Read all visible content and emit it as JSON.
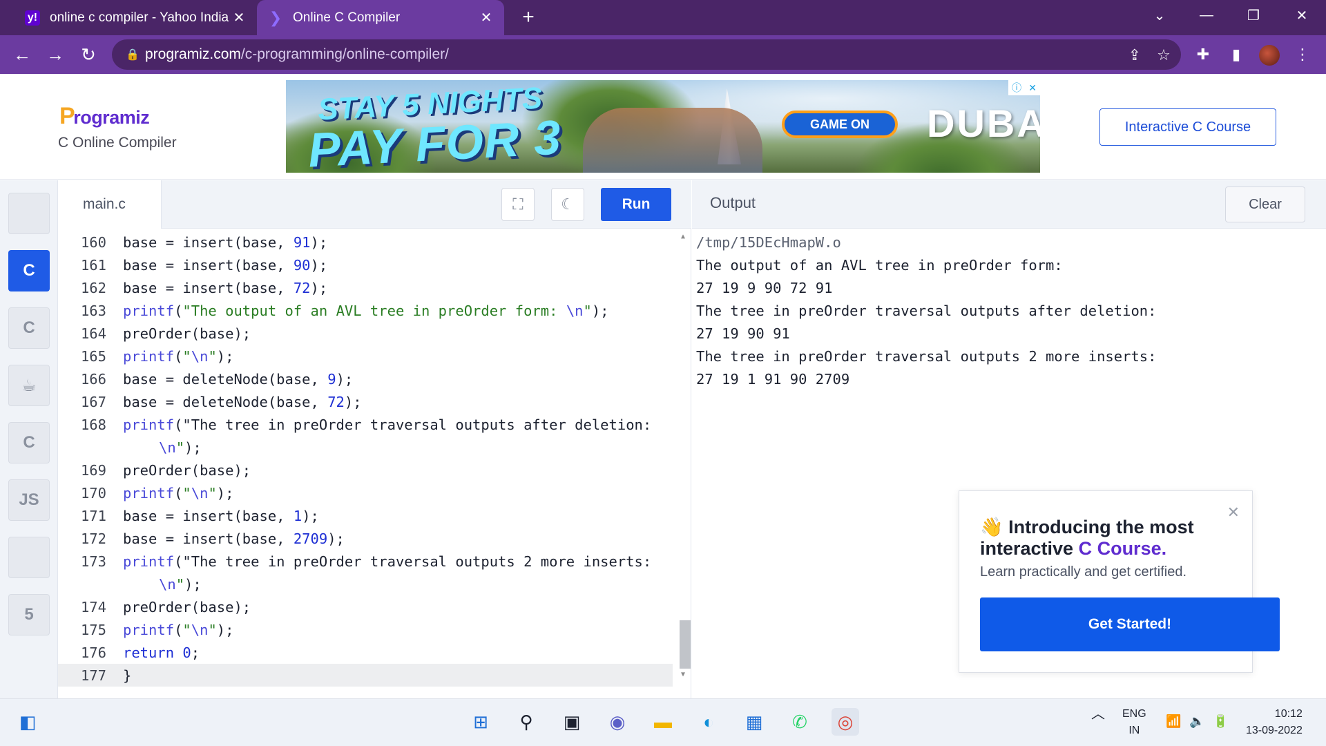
{
  "browser": {
    "tabs": [
      {
        "title": "online c compiler - Yahoo India S",
        "favicon": "yahoo-icon",
        "active": false
      },
      {
        "title": "Online C Compiler",
        "favicon": "programiz-icon",
        "active": true
      }
    ],
    "url_domain": "programiz.com",
    "url_path": "/c-programming/online-compiler/"
  },
  "header": {
    "logo_text": "rogramiz",
    "logo_initial": "P",
    "subtitle": "C Online Compiler",
    "ad": {
      "headline1": "STAY 5 NIGHTS",
      "headline2": "PAY FOR 3",
      "button": "GAME ON",
      "brand": "DUBAI"
    },
    "course_button": "Interactive C Course"
  },
  "languages": [
    {
      "name": "python-icon",
      "label": "",
      "active": false
    },
    {
      "name": "c-icon",
      "label": "C",
      "active": true
    },
    {
      "name": "cpp-icon",
      "label": "C",
      "active": false
    },
    {
      "name": "java-icon",
      "label": "☕",
      "active": false
    },
    {
      "name": "csharp-icon",
      "label": "C",
      "active": false
    },
    {
      "name": "js-icon",
      "label": "JS",
      "active": false
    },
    {
      "name": "sql-icon",
      "label": "",
      "active": false
    },
    {
      "name": "html5-icon",
      "label": "5",
      "active": false
    }
  ],
  "editor": {
    "file_name": "main.c",
    "run_label": "Run",
    "active_line": "177"
  },
  "code_lines": [
    {
      "ln": "160",
      "text": "base = insert(base, 91);"
    },
    {
      "ln": "161",
      "text": "base = insert(base, 90);"
    },
    {
      "ln": "162",
      "text": "base = insert(base, 72);"
    },
    {
      "ln": "163",
      "text": "printf(\"The output of an AVL tree in preOrder form: \\n\");"
    },
    {
      "ln": "164",
      "text": "preOrder(base);"
    },
    {
      "ln": "165",
      "text": "printf(\"\\n\");"
    },
    {
      "ln": "166",
      "text": "base = deleteNode(base, 9);"
    },
    {
      "ln": "167",
      "text": "base = deleteNode(base, 72);"
    },
    {
      "ln": "168",
      "text": "printf(\"The tree in preOrder traversal outputs after deletion:"
    },
    {
      "ln": "",
      "text": "\\n\");"
    },
    {
      "ln": "169",
      "text": "preOrder(base);"
    },
    {
      "ln": "170",
      "text": "printf(\"\\n\");"
    },
    {
      "ln": "171",
      "text": "base = insert(base, 1);"
    },
    {
      "ln": "172",
      "text": "base = insert(base, 2709);"
    },
    {
      "ln": "173",
      "text": "printf(\"The tree in preOrder traversal outputs 2 more inserts:"
    },
    {
      "ln": "",
      "text": "\\n\");"
    },
    {
      "ln": "174",
      "text": "preOrder(base);"
    },
    {
      "ln": "175",
      "text": "printf(\"\\n\");"
    },
    {
      "ln": "176",
      "text": "return 0;"
    },
    {
      "ln": "177",
      "text": "}"
    }
  ],
  "output": {
    "title": "Output",
    "clear_label": "Clear",
    "lines": [
      "/tmp/15DEcHmapW.o",
      "The output of an AVL tree in preOrder form:",
      "27 19 9 90 72 91",
      "The tree in preOrder traversal outputs after deletion:",
      "27 19 90 91",
      "The tree in preOrder traversal outputs 2 more inserts:",
      "27 19 1 91 90 2709"
    ]
  },
  "promo": {
    "line1": "Introducing the most",
    "line2_prefix": "interactive ",
    "line2_highlight": "C Course.",
    "description": "Learn practically and get certified.",
    "cta": "Get Started!"
  },
  "taskbar": {
    "lang_top": "ENG",
    "lang_bottom": "IN",
    "time": "10:12",
    "date": "13-09-2022"
  },
  "colors": {
    "accent": "#1f5be6",
    "brand_purple": "#5f2ccf",
    "chrome_frame": "#4a2567",
    "chrome_toolbar": "#6b3ba0"
  }
}
